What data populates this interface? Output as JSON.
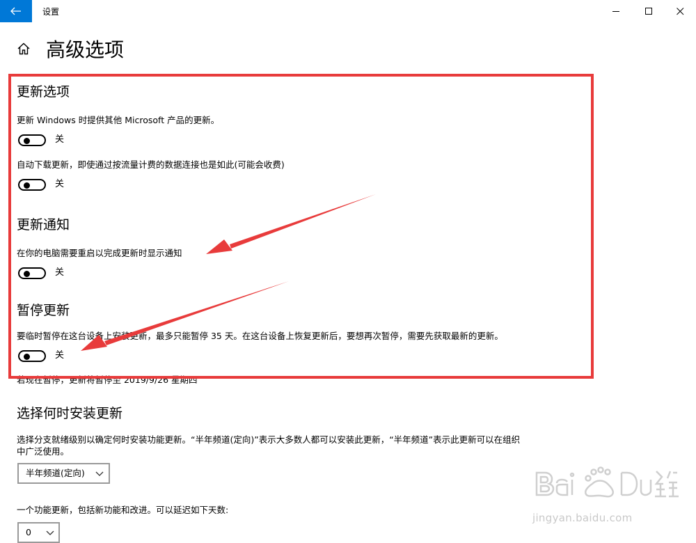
{
  "window": {
    "title": "设置",
    "back_icon": "arrow-left-icon",
    "controls": [
      "minimize-icon",
      "maximize-icon",
      "close-icon"
    ]
  },
  "page": {
    "title": "高级选项",
    "home_icon": "home-icon"
  },
  "colors": {
    "accent": "#0078d7",
    "annotation": "#e83b3b",
    "text": "#000000",
    "dropdown_border": "#999999"
  },
  "sections": {
    "update_options": {
      "heading": "更新选项",
      "items": [
        {
          "description": "更新 Windows 时提供其他 Microsoft 产品的更新。",
          "state": "关"
        },
        {
          "description": "自动下载更新，即使通过按流量计费的数据连接也是如此(可能会收费)",
          "state": "关"
        }
      ]
    },
    "update_notifications": {
      "heading": "更新通知",
      "items": [
        {
          "description": "在你的电脑需要重启以完成更新时显示通知",
          "state": "关"
        }
      ]
    },
    "pause_updates": {
      "heading": "暂停更新",
      "description": "要临时暂停在这台设备上安装更新，最多只能暂停 35 天。在这台设备上恢复更新后，要想再次暂停，需要先获取最新的更新。",
      "state": "关",
      "note": "若现在暂停，更新将暂停至 2019/9/26 星期四"
    },
    "install_timing": {
      "heading": "选择何时安装更新",
      "description_line1": "选择分支就绪级别以确定何时安装功能更新。“半年频道(定向)”表示大多数人都可以安装此更新，“半年频道”表示此更新可以在组织",
      "description_line2": "中广泛使用。",
      "channel_selected": "半年频道(定向)",
      "feature_defer_label": "一个功能更新，包括新功能和改进。可以延迟如下天数:",
      "feature_defer_days": "0"
    }
  },
  "watermark": {
    "logo_icon": "baidu-jingyan-logo",
    "url": "jingyan.baidu.com"
  }
}
